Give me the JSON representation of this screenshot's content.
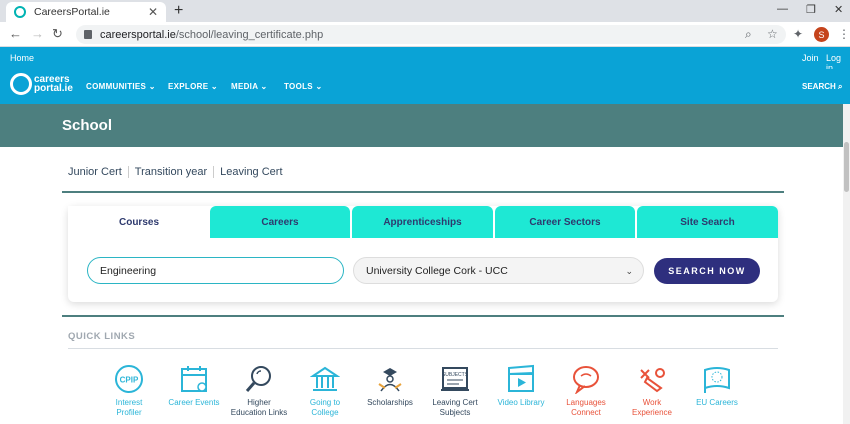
{
  "browser": {
    "tab_title": "CareersPortal.ie",
    "url_domain": "careersportal.ie",
    "url_path": "/school/leaving_certificate.php",
    "avatar_letter": "S"
  },
  "header": {
    "home": "Home",
    "join": "Join",
    "login": "Log in",
    "logo_line1": "careers",
    "logo_line2": "portal.ie",
    "nav": [
      "COMMUNITIES",
      "EXPLORE",
      "MEDIA",
      "TOOLS"
    ],
    "search": "SEARCH"
  },
  "banner": {
    "title": "School"
  },
  "subnav": [
    "Junior Cert",
    "Transition year",
    "Leaving Cert"
  ],
  "search_card": {
    "tabs": [
      "Courses",
      "Careers",
      "Apprenticeships",
      "Career Sectors",
      "Site Search"
    ],
    "input_value": "Engineering",
    "college_selected": "University College Cork - UCC",
    "button": "SEARCH NOW"
  },
  "quick_links": {
    "title": "QUICK LINKS",
    "items": [
      {
        "line1": "Interest",
        "line2": "Profiler",
        "icon": "cpip-icon",
        "color": "#2bb5d8"
      },
      {
        "line1": "Career Events",
        "line2": "",
        "icon": "calendar-icon",
        "color": "#2bb5d8"
      },
      {
        "line1": "Higher",
        "line2": "Education Links",
        "icon": "magnifier-icon",
        "color": "#34495e"
      },
      {
        "line1": "Going to",
        "line2": "College",
        "icon": "college-icon",
        "color": "#2bb5d8"
      },
      {
        "line1": "Scholarships",
        "line2": "",
        "icon": "scholarship-icon",
        "color": "#34495e"
      },
      {
        "line1": "Leaving Cert",
        "line2": "Subjects",
        "icon": "subjects-icon",
        "color": "#34495e"
      },
      {
        "line1": "Video Library",
        "line2": "",
        "icon": "video-icon",
        "color": "#2bb5d8"
      },
      {
        "line1": "Languages",
        "line2": "Connect",
        "icon": "speech-icon",
        "color": "#e8523a"
      },
      {
        "line1": "Work",
        "line2": "Experience",
        "icon": "work-icon",
        "color": "#e8523a"
      },
      {
        "line1": "EU Careers",
        "line2": "",
        "icon": "eu-flag-icon",
        "color": "#2bb5d8"
      }
    ]
  }
}
